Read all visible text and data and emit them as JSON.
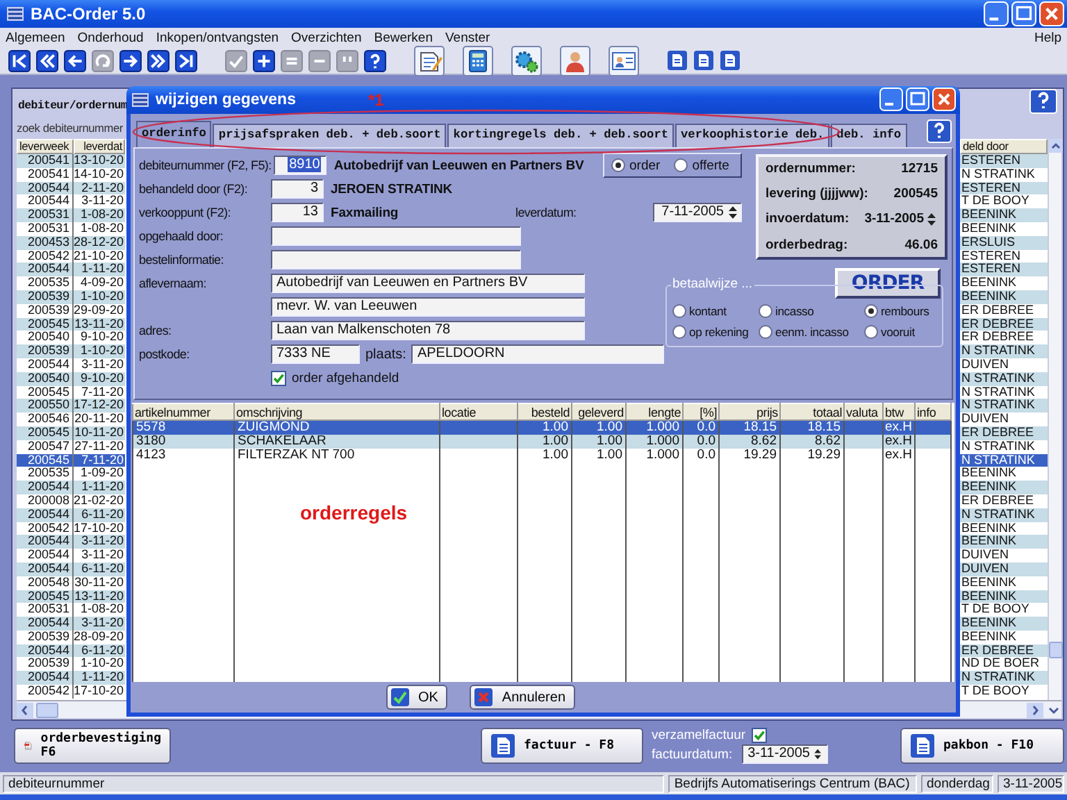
{
  "app": {
    "title": "BAC-Order 5.0"
  },
  "menu": [
    "Algemeen",
    "Onderhoud",
    "Inkopen/ontvangsten",
    "Overzichten",
    "Bewerken",
    "Venster"
  ],
  "help_menu": "Help",
  "toolbar": [
    {
      "kind": "first",
      "disabled": false
    },
    {
      "kind": "prev-page",
      "disabled": false
    },
    {
      "kind": "prev",
      "disabled": false
    },
    {
      "kind": "refresh",
      "disabled": true
    },
    {
      "kind": "next",
      "disabled": false
    },
    {
      "kind": "next-page",
      "disabled": false
    },
    {
      "kind": "last",
      "disabled": false
    },
    {
      "kind": "check",
      "disabled": true
    },
    {
      "kind": "plus",
      "disabled": false
    },
    {
      "kind": "equal",
      "disabled": true
    },
    {
      "kind": "minus",
      "disabled": true
    },
    {
      "kind": "quote",
      "disabled": true
    },
    {
      "kind": "help",
      "disabled": false
    },
    {
      "kind": "document",
      "disabled": false
    },
    {
      "kind": "calculator",
      "disabled": false
    },
    {
      "kind": "gears",
      "disabled": false
    },
    {
      "kind": "person",
      "disabled": false
    },
    {
      "kind": "person-card",
      "disabled": false
    },
    {
      "kind": "small-doc",
      "disabled": false
    },
    {
      "kind": "small-doc",
      "disabled": false
    },
    {
      "kind": "small-doc",
      "disabled": false
    }
  ],
  "list_panel": {
    "title": "debiteur/ordernum",
    "search_label": "zoek debiteurnummer",
    "columns": [
      "leverweek",
      "leverdat",
      "deld door"
    ],
    "rows": [
      {
        "leverweek": "200541",
        "leverdatum": "13-10-20",
        "behandeld": "ESTEREN",
        "selected": false
      },
      {
        "leverweek": "200541",
        "leverdatum": "14-10-20",
        "behandeld": "N STRATINK",
        "selected": false
      },
      {
        "leverweek": "200544",
        "leverdatum": "2-11-20",
        "behandeld": "ESTEREN",
        "selected": false
      },
      {
        "leverweek": "200544",
        "leverdatum": "3-11-20",
        "behandeld": "T DE BOOY",
        "selected": false
      },
      {
        "leverweek": "200531",
        "leverdatum": "1-08-20",
        "behandeld": "BEENINK",
        "selected": false
      },
      {
        "leverweek": "200531",
        "leverdatum": "1-08-20",
        "behandeld": "BEENINK",
        "selected": false
      },
      {
        "leverweek": "200453",
        "leverdatum": "28-12-20",
        "behandeld": "ERSLUIS",
        "selected": false
      },
      {
        "leverweek": "200542",
        "leverdatum": "21-10-20",
        "behandeld": "ESTEREN",
        "selected": false
      },
      {
        "leverweek": "200544",
        "leverdatum": "1-11-20",
        "behandeld": "ESTEREN",
        "selected": false
      },
      {
        "leverweek": "200535",
        "leverdatum": "4-09-20",
        "behandeld": "BEENINK",
        "selected": false
      },
      {
        "leverweek": "200539",
        "leverdatum": "1-10-20",
        "behandeld": "BEENINK",
        "selected": false
      },
      {
        "leverweek": "200539",
        "leverdatum": "29-09-20",
        "behandeld": "ER DEBREE",
        "selected": false
      },
      {
        "leverweek": "200545",
        "leverdatum": "13-11-20",
        "behandeld": "ER DEBREE",
        "selected": false
      },
      {
        "leverweek": "200540",
        "leverdatum": "9-10-20",
        "behandeld": "ER DEBREE",
        "selected": false
      },
      {
        "leverweek": "200539",
        "leverdatum": "1-10-20",
        "behandeld": "N STRATINK",
        "selected": false
      },
      {
        "leverweek": "200544",
        "leverdatum": "3-11-20",
        "behandeld": "DUIVEN",
        "selected": false
      },
      {
        "leverweek": "200540",
        "leverdatum": "9-10-20",
        "behandeld": "N STRATINK",
        "selected": false
      },
      {
        "leverweek": "200545",
        "leverdatum": "7-11-20",
        "behandeld": "N STRATINK",
        "selected": false
      },
      {
        "leverweek": "200550",
        "leverdatum": "17-12-20",
        "behandeld": "N STRATINK",
        "selected": false
      },
      {
        "leverweek": "200546",
        "leverdatum": "20-11-20",
        "behandeld": "DUIVEN",
        "selected": false
      },
      {
        "leverweek": "200545",
        "leverdatum": "10-11-20",
        "behandeld": "ER DEBREE",
        "selected": false
      },
      {
        "leverweek": "200547",
        "leverdatum": "27-11-20",
        "behandeld": "N STRATINK",
        "selected": false
      },
      {
        "leverweek": "200545",
        "leverdatum": "7-11-20",
        "behandeld": "N STRATINK",
        "selected": true
      },
      {
        "leverweek": "200535",
        "leverdatum": "1-09-20",
        "behandeld": "BEENINK",
        "selected": false
      },
      {
        "leverweek": "200544",
        "leverdatum": "1-11-20",
        "behandeld": "BEENINK",
        "selected": false
      },
      {
        "leverweek": "200008",
        "leverdatum": "21-02-20",
        "behandeld": "ER DEBREE",
        "selected": false
      },
      {
        "leverweek": "200544",
        "leverdatum": "6-11-20",
        "behandeld": "N STRATINK",
        "selected": false
      },
      {
        "leverweek": "200542",
        "leverdatum": "17-10-20",
        "behandeld": "BEENINK",
        "selected": false
      },
      {
        "leverweek": "200544",
        "leverdatum": "3-11-20",
        "behandeld": "BEENINK",
        "selected": false
      },
      {
        "leverweek": "200544",
        "leverdatum": "3-11-20",
        "behandeld": "DUIVEN",
        "selected": false
      },
      {
        "leverweek": "200544",
        "leverdatum": "6-11-20",
        "behandeld": "DUIVEN",
        "selected": false
      },
      {
        "leverweek": "200548",
        "leverdatum": "30-11-20",
        "behandeld": "BEENINK",
        "selected": false
      },
      {
        "leverweek": "200545",
        "leverdatum": "13-11-20",
        "behandeld": "BEENINK",
        "selected": false
      },
      {
        "leverweek": "200531",
        "leverdatum": "1-08-20",
        "behandeld": "T DE BOOY",
        "selected": false
      },
      {
        "leverweek": "200544",
        "leverdatum": "3-11-20",
        "behandeld": "BEENINK",
        "selected": false
      },
      {
        "leverweek": "200539",
        "leverdatum": "28-09-20",
        "behandeld": "BEENINK",
        "selected": false
      },
      {
        "leverweek": "200544",
        "leverdatum": "6-11-20",
        "behandeld": "ER DEBREE",
        "selected": false
      },
      {
        "leverweek": "200539",
        "leverdatum": "1-10-20",
        "behandeld": "ND DE BOER",
        "selected": false
      },
      {
        "leverweek": "200544",
        "leverdatum": "1-11-20",
        "behandeld": "N STRATINK",
        "selected": false
      },
      {
        "leverweek": "200542",
        "leverdatum": "17-10-20",
        "behandeld": "T DE BOOY",
        "selected": false
      }
    ]
  },
  "dialog": {
    "title": "wijzigen gegevens",
    "mark": "*1",
    "tabs": [
      {
        "label": "orderinfo",
        "selected": true
      },
      {
        "label": "prijsafspraken deb. + deb.soort",
        "selected": false
      },
      {
        "label": "kortingregels deb. + deb.soort",
        "selected": false
      },
      {
        "label": "verkoophistorie deb.",
        "selected": false
      },
      {
        "label": "deb. info",
        "selected": false
      }
    ],
    "debtor": {
      "label": "debiteurnummer (F2, F5):",
      "value": "8910",
      "text_selected": true,
      "name": "Autobedrijf van Leeuwen en Partners BV"
    },
    "order_type": [
      {
        "label": "order",
        "selected": true
      },
      {
        "label": "offerte",
        "selected": false
      }
    ],
    "handled_by": {
      "label": "behandeld door (F2):",
      "value": "3",
      "name": "JEROEN STRATINK"
    },
    "sales_point": {
      "label": "verkooppunt (F2):",
      "value": "13",
      "name": "Faxmailing"
    },
    "delivery_date": {
      "label": "leverdatum:",
      "value": "7-11-2005"
    },
    "picked_up_by": {
      "label": "opgehaald door:"
    },
    "order_info": {
      "label": "bestelinformatie:"
    },
    "delivery_name": {
      "label": "aflevernaam:",
      "lines": [
        "Autobedrijf van Leeuwen en Partners BV",
        "mevr. W. van Leeuwen"
      ]
    },
    "address": {
      "label": "adres:",
      "value": "Laan van Malkenschoten 78"
    },
    "postcode": {
      "label": "postkode:",
      "value": "7333 NE"
    },
    "city": {
      "label": "plaats:",
      "value": "APELDOORN"
    },
    "completed": {
      "label": "order afgehandeld",
      "checked": true
    },
    "summary": [
      {
        "label": "ordernummer:",
        "value": "12715",
        "kind": "text"
      },
      {
        "label": "levering (jjjjww):",
        "value": "200545",
        "kind": "text"
      },
      {
        "label": "invoerdatum:",
        "value": "3-11-2005",
        "kind": "spinner"
      },
      {
        "label": "orderbedrag:",
        "value": "46.06",
        "kind": "text"
      }
    ],
    "order_button": "ORDER",
    "payment": {
      "title": "betaalwijze ...",
      "options": [
        {
          "label": "kontant",
          "selected": false
        },
        {
          "label": "incasso",
          "selected": false
        },
        {
          "label": "rembours",
          "selected": true
        },
        {
          "label": "op rekening",
          "selected": false
        },
        {
          "label": "eenm. incasso",
          "selected": false
        },
        {
          "label": "vooruit",
          "selected": false
        }
      ]
    },
    "order_lines": {
      "label": "orderregels",
      "columns": [
        "artikelnummer",
        "omschrijving",
        "locatie",
        "besteld",
        "geleverd",
        "lengte",
        "[%]",
        "prijs",
        "totaal",
        "valuta",
        "btw",
        "info"
      ],
      "rows": [
        {
          "cells": [
            "5578",
            "ZUIGMOND",
            "",
            "1.00",
            "1.00",
            "1.000",
            "0.0",
            "18.15",
            "18.15",
            "",
            "ex.H",
            ""
          ],
          "selected": true
        },
        {
          "cells": [
            "3180",
            "SCHAKELAAR",
            "",
            "1.00",
            "1.00",
            "1.000",
            "0.0",
            "8.62",
            "8.62",
            "",
            "ex.H",
            ""
          ],
          "selected": false
        },
        {
          "cells": [
            "4123",
            "FILTERZAK NT 700",
            "",
            "1.00",
            "1.00",
            "1.000",
            "0.0",
            "19.29",
            "19.29",
            "",
            "ex.H",
            ""
          ],
          "selected": false
        }
      ]
    },
    "buttons": [
      {
        "label": "OK",
        "kind": "ok"
      },
      {
        "label": "Annuleren",
        "kind": "cancel"
      }
    ]
  },
  "bottom": {
    "buttons": [
      {
        "kind": "pdf",
        "lines": [
          "orderbevestiging",
          "F6"
        ]
      },
      {
        "kind": "doc",
        "lines": [
          "factuur - F8"
        ]
      },
      {
        "kind": "doc",
        "lines": [
          "pakbon - F10"
        ]
      }
    ],
    "collective_invoice": {
      "label": "verzamelfactuur",
      "checked": true
    },
    "invoice_date": {
      "label": "factuurdatum:",
      "value": "3-11-2005"
    }
  },
  "status_bar": [
    "debiteurnummer",
    "Bedrijfs Automatiserings Centrum (BAC)",
    "donderdag",
    "3-11-2005"
  ]
}
